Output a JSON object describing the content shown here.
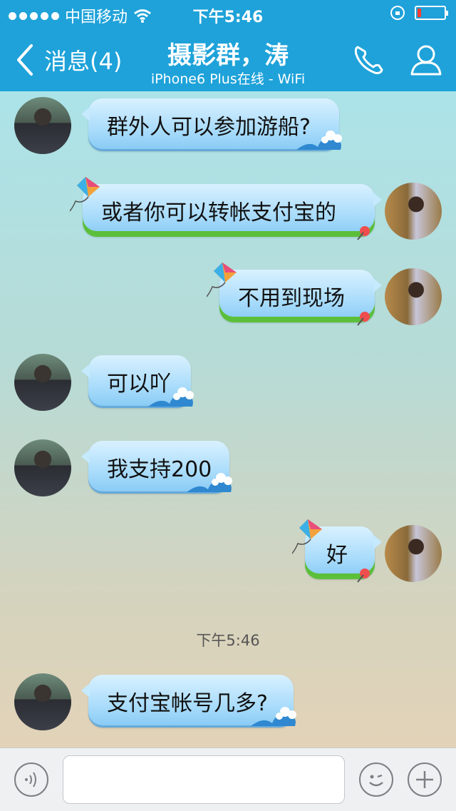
{
  "status_bar": {
    "carrier": "中国移动",
    "time": "下午5:46",
    "signal_bars": 5,
    "battery_level": 0.15,
    "battery_color": "#ff3b30"
  },
  "header": {
    "back_label": "消息(4)",
    "title": "摄影群，涛",
    "subtitle": "iPhone6 Plus在线 - WiFi",
    "accent_color": "#1ea2d9",
    "icons": [
      "phone-icon",
      "contact-profile-icon"
    ]
  },
  "messages": [
    {
      "sender": "other",
      "text": "群外人可以参加游船?"
    },
    {
      "sender": "self",
      "text": "或者你可以转帐支付宝的"
    },
    {
      "sender": "self",
      "text": "不用到现场"
    },
    {
      "sender": "other",
      "text": "可以吖"
    },
    {
      "sender": "other",
      "text": "我支持200"
    },
    {
      "sender": "self",
      "text": "好"
    },
    {
      "sender": "other",
      "text": "支付宝帐号几多?"
    }
  ],
  "timestamp_divider": "下午5:46",
  "input_bar": {
    "text_value": "",
    "icons": [
      "voice-icon",
      "emoji-icon",
      "plus-icon"
    ]
  }
}
